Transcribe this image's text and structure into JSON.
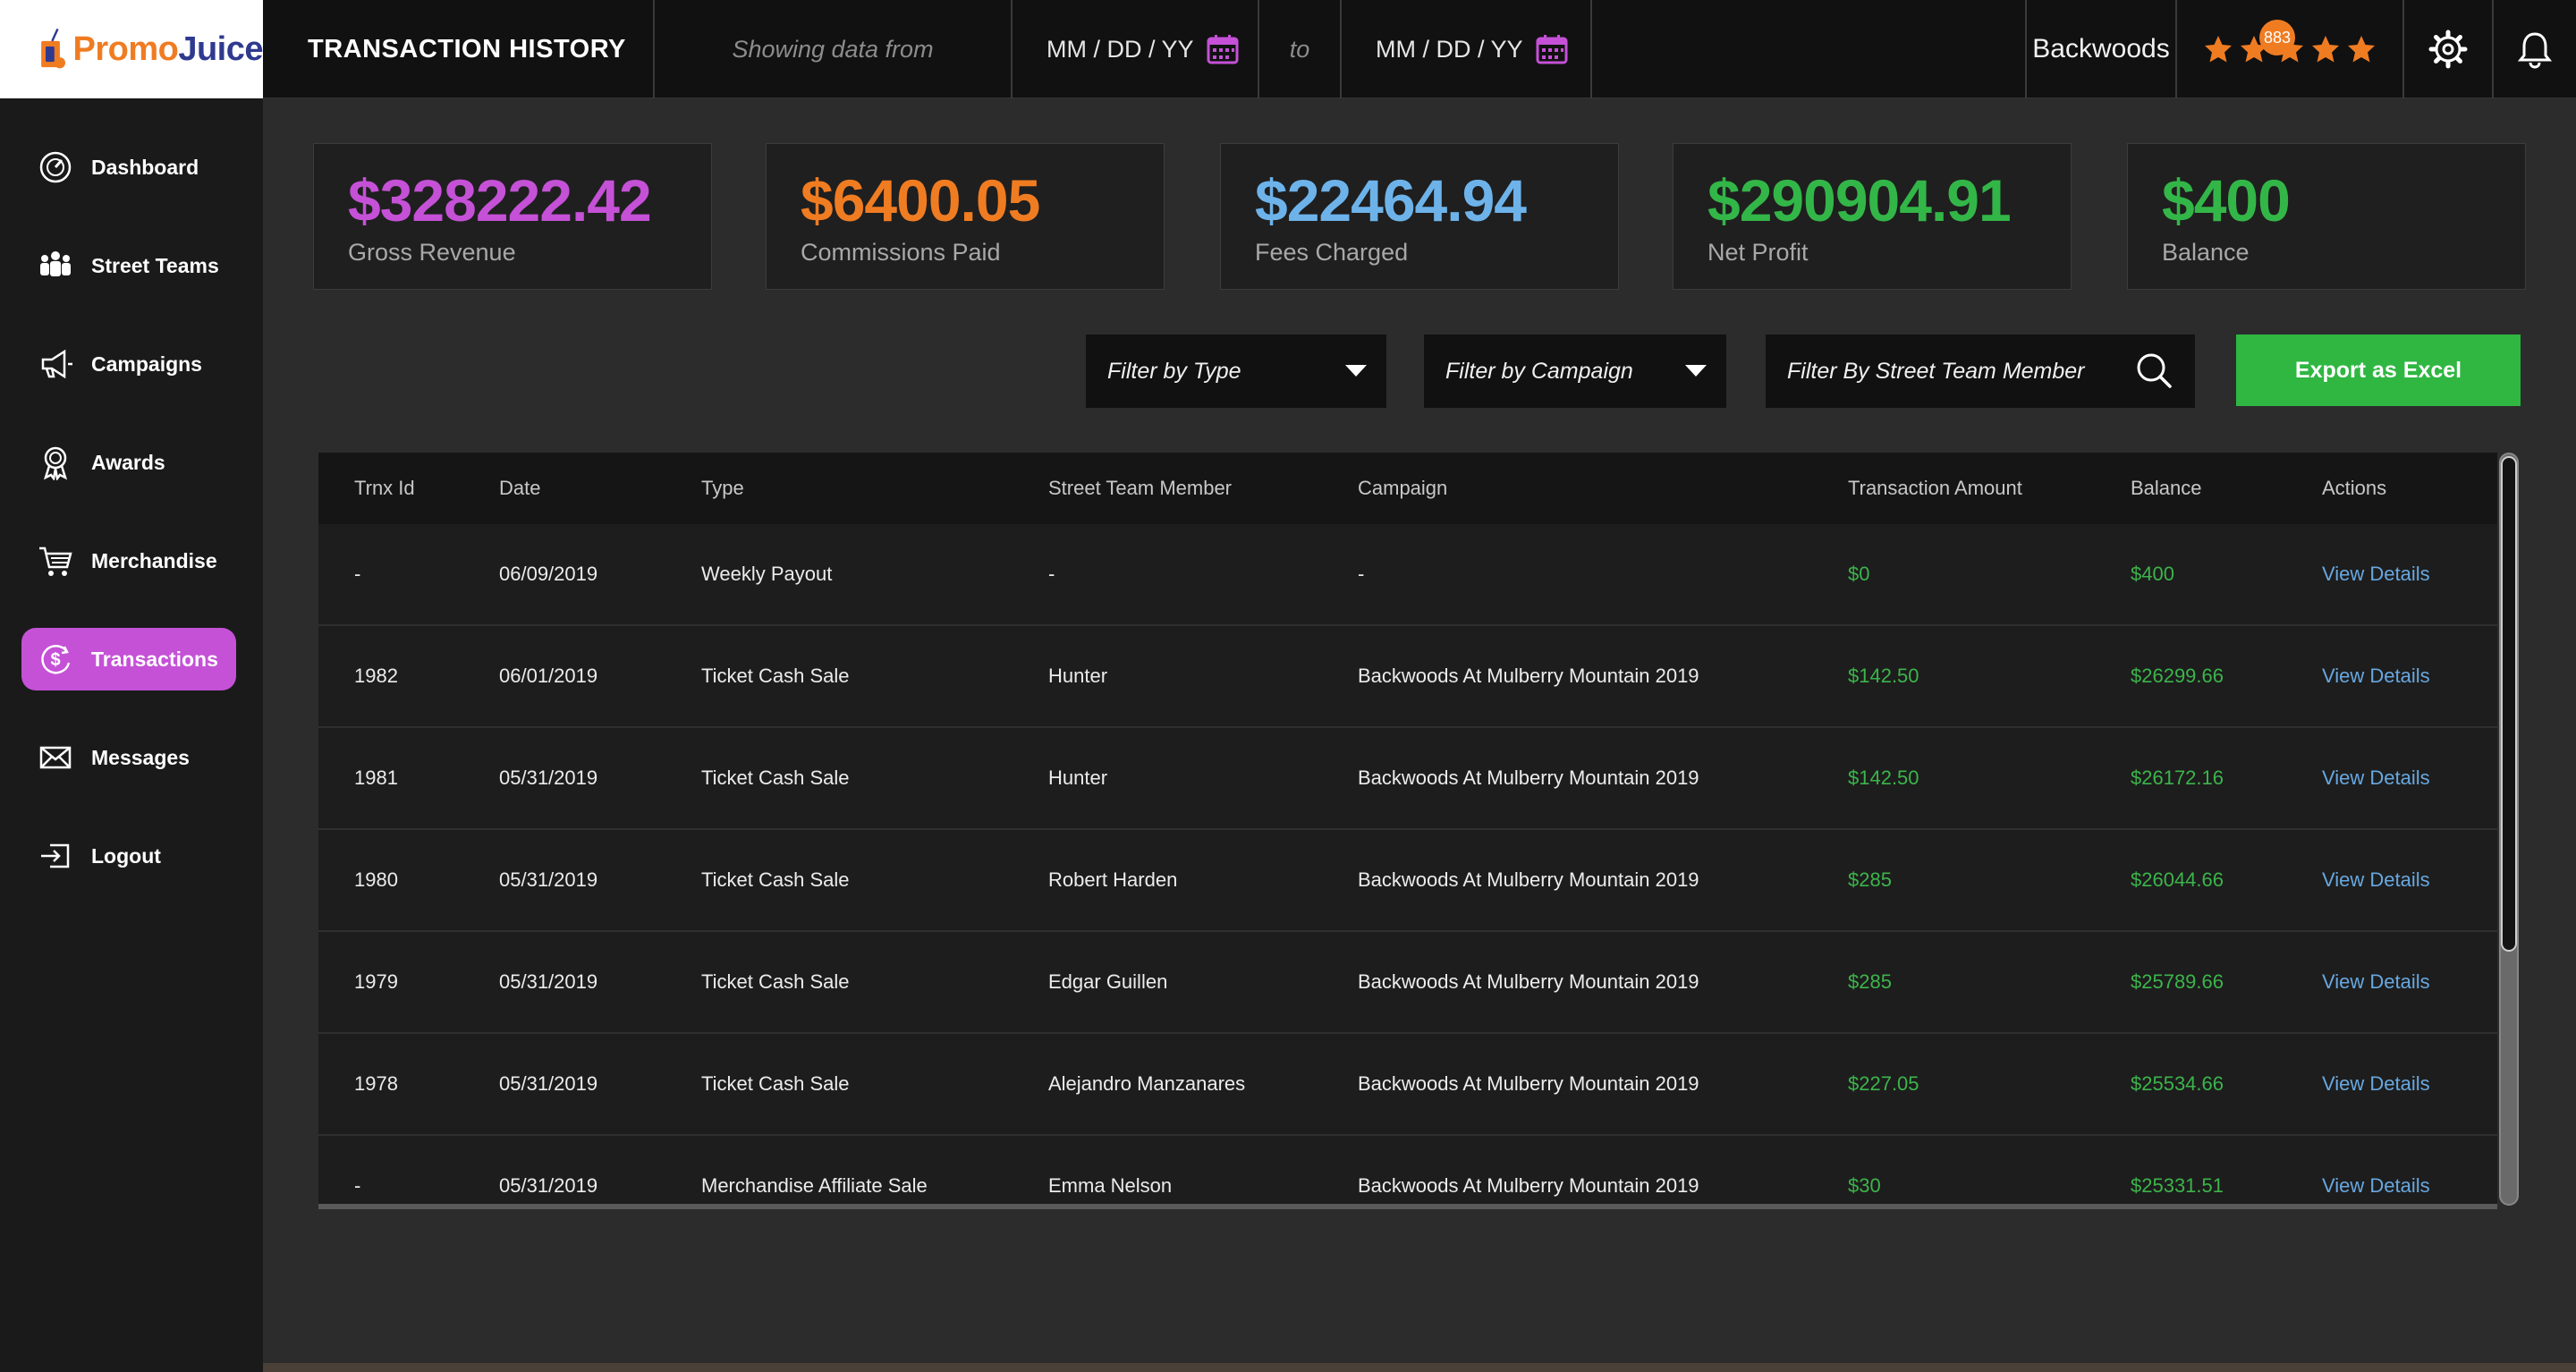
{
  "logo": {
    "part1": "Promo",
    "part2": "Juice"
  },
  "header": {
    "title": "TRANSACTION HISTORY",
    "showing_label": "Showing data from",
    "date_from": "MM / DD / YY",
    "to_label": "to",
    "date_to": "MM / DD / YY",
    "brand": "Backwoods",
    "rating": 5,
    "notification_count": "883"
  },
  "sidebar": {
    "items": [
      {
        "label": "Dashboard",
        "icon": "dashboard-icon"
      },
      {
        "label": "Street Teams",
        "icon": "people-icon"
      },
      {
        "label": "Campaigns",
        "icon": "megaphone-icon"
      },
      {
        "label": "Awards",
        "icon": "award-icon"
      },
      {
        "label": "Merchandise",
        "icon": "cart-icon"
      },
      {
        "label": "Transactions",
        "icon": "dollar-icon",
        "active": true
      },
      {
        "label": "Messages",
        "icon": "envelope-icon"
      },
      {
        "label": "Logout",
        "icon": "logout-icon"
      }
    ]
  },
  "stats": [
    {
      "value": "$328222.42",
      "label": "Gross Revenue",
      "color": "#c551d7"
    },
    {
      "value": "$6400.05",
      "label": "Commissions Paid",
      "color": "#f07c22"
    },
    {
      "value": "$22464.94",
      "label": "Fees Charged",
      "color": "#6db3ea"
    },
    {
      "value": "$290904.91",
      "label": "Net Profit",
      "color": "#33b648"
    },
    {
      "value": "$400",
      "label": "Balance",
      "color": "#33b648"
    }
  ],
  "filters": {
    "type_label": "Filter by Type",
    "campaign_label": "Filter by Campaign",
    "member_placeholder": "Filter By Street Team Member",
    "export_label": "Export as Excel"
  },
  "table": {
    "columns": [
      "Trnx Id",
      "Date",
      "Type",
      "Street Team Member",
      "Campaign",
      "Transaction Amount",
      "Balance",
      "Actions"
    ],
    "rows": [
      {
        "id": "-",
        "date": "06/09/2019",
        "type": "Weekly Payout",
        "member": "-",
        "campaign": "-",
        "amount": "$0",
        "balance": "$400",
        "action": "View Details"
      },
      {
        "id": "1982",
        "date": "06/01/2019",
        "type": "Ticket Cash Sale",
        "member": "Hunter",
        "campaign": "Backwoods At Mulberry Mountain 2019",
        "amount": "$142.50",
        "balance": "$26299.66",
        "action": "View Details"
      },
      {
        "id": "1981",
        "date": "05/31/2019",
        "type": "Ticket Cash Sale",
        "member": "Hunter",
        "campaign": "Backwoods At Mulberry Mountain 2019",
        "amount": "$142.50",
        "balance": "$26172.16",
        "action": "View Details"
      },
      {
        "id": "1980",
        "date": "05/31/2019",
        "type": "Ticket Cash Sale",
        "member": "Robert Harden",
        "campaign": "Backwoods At Mulberry Mountain 2019",
        "amount": "$285",
        "balance": "$26044.66",
        "action": "View Details"
      },
      {
        "id": "1979",
        "date": "05/31/2019",
        "type": "Ticket Cash Sale",
        "member": "Edgar Guillen",
        "campaign": "Backwoods At Mulberry Mountain 2019",
        "amount": "$285",
        "balance": "$25789.66",
        "action": "View Details"
      },
      {
        "id": "1978",
        "date": "05/31/2019",
        "type": "Ticket Cash Sale",
        "member": "Alejandro Manzanares",
        "campaign": "Backwoods At Mulberry Mountain 2019",
        "amount": "$227.05",
        "balance": "$25534.66",
        "action": "View Details"
      },
      {
        "id": "-",
        "date": "05/31/2019",
        "type": "Merchandise Affiliate Sale",
        "member": "Emma Nelson",
        "campaign": "Backwoods At Mulberry Mountain 2019",
        "amount": "$30",
        "balance": "$25331.51",
        "action": "View Details"
      }
    ]
  }
}
